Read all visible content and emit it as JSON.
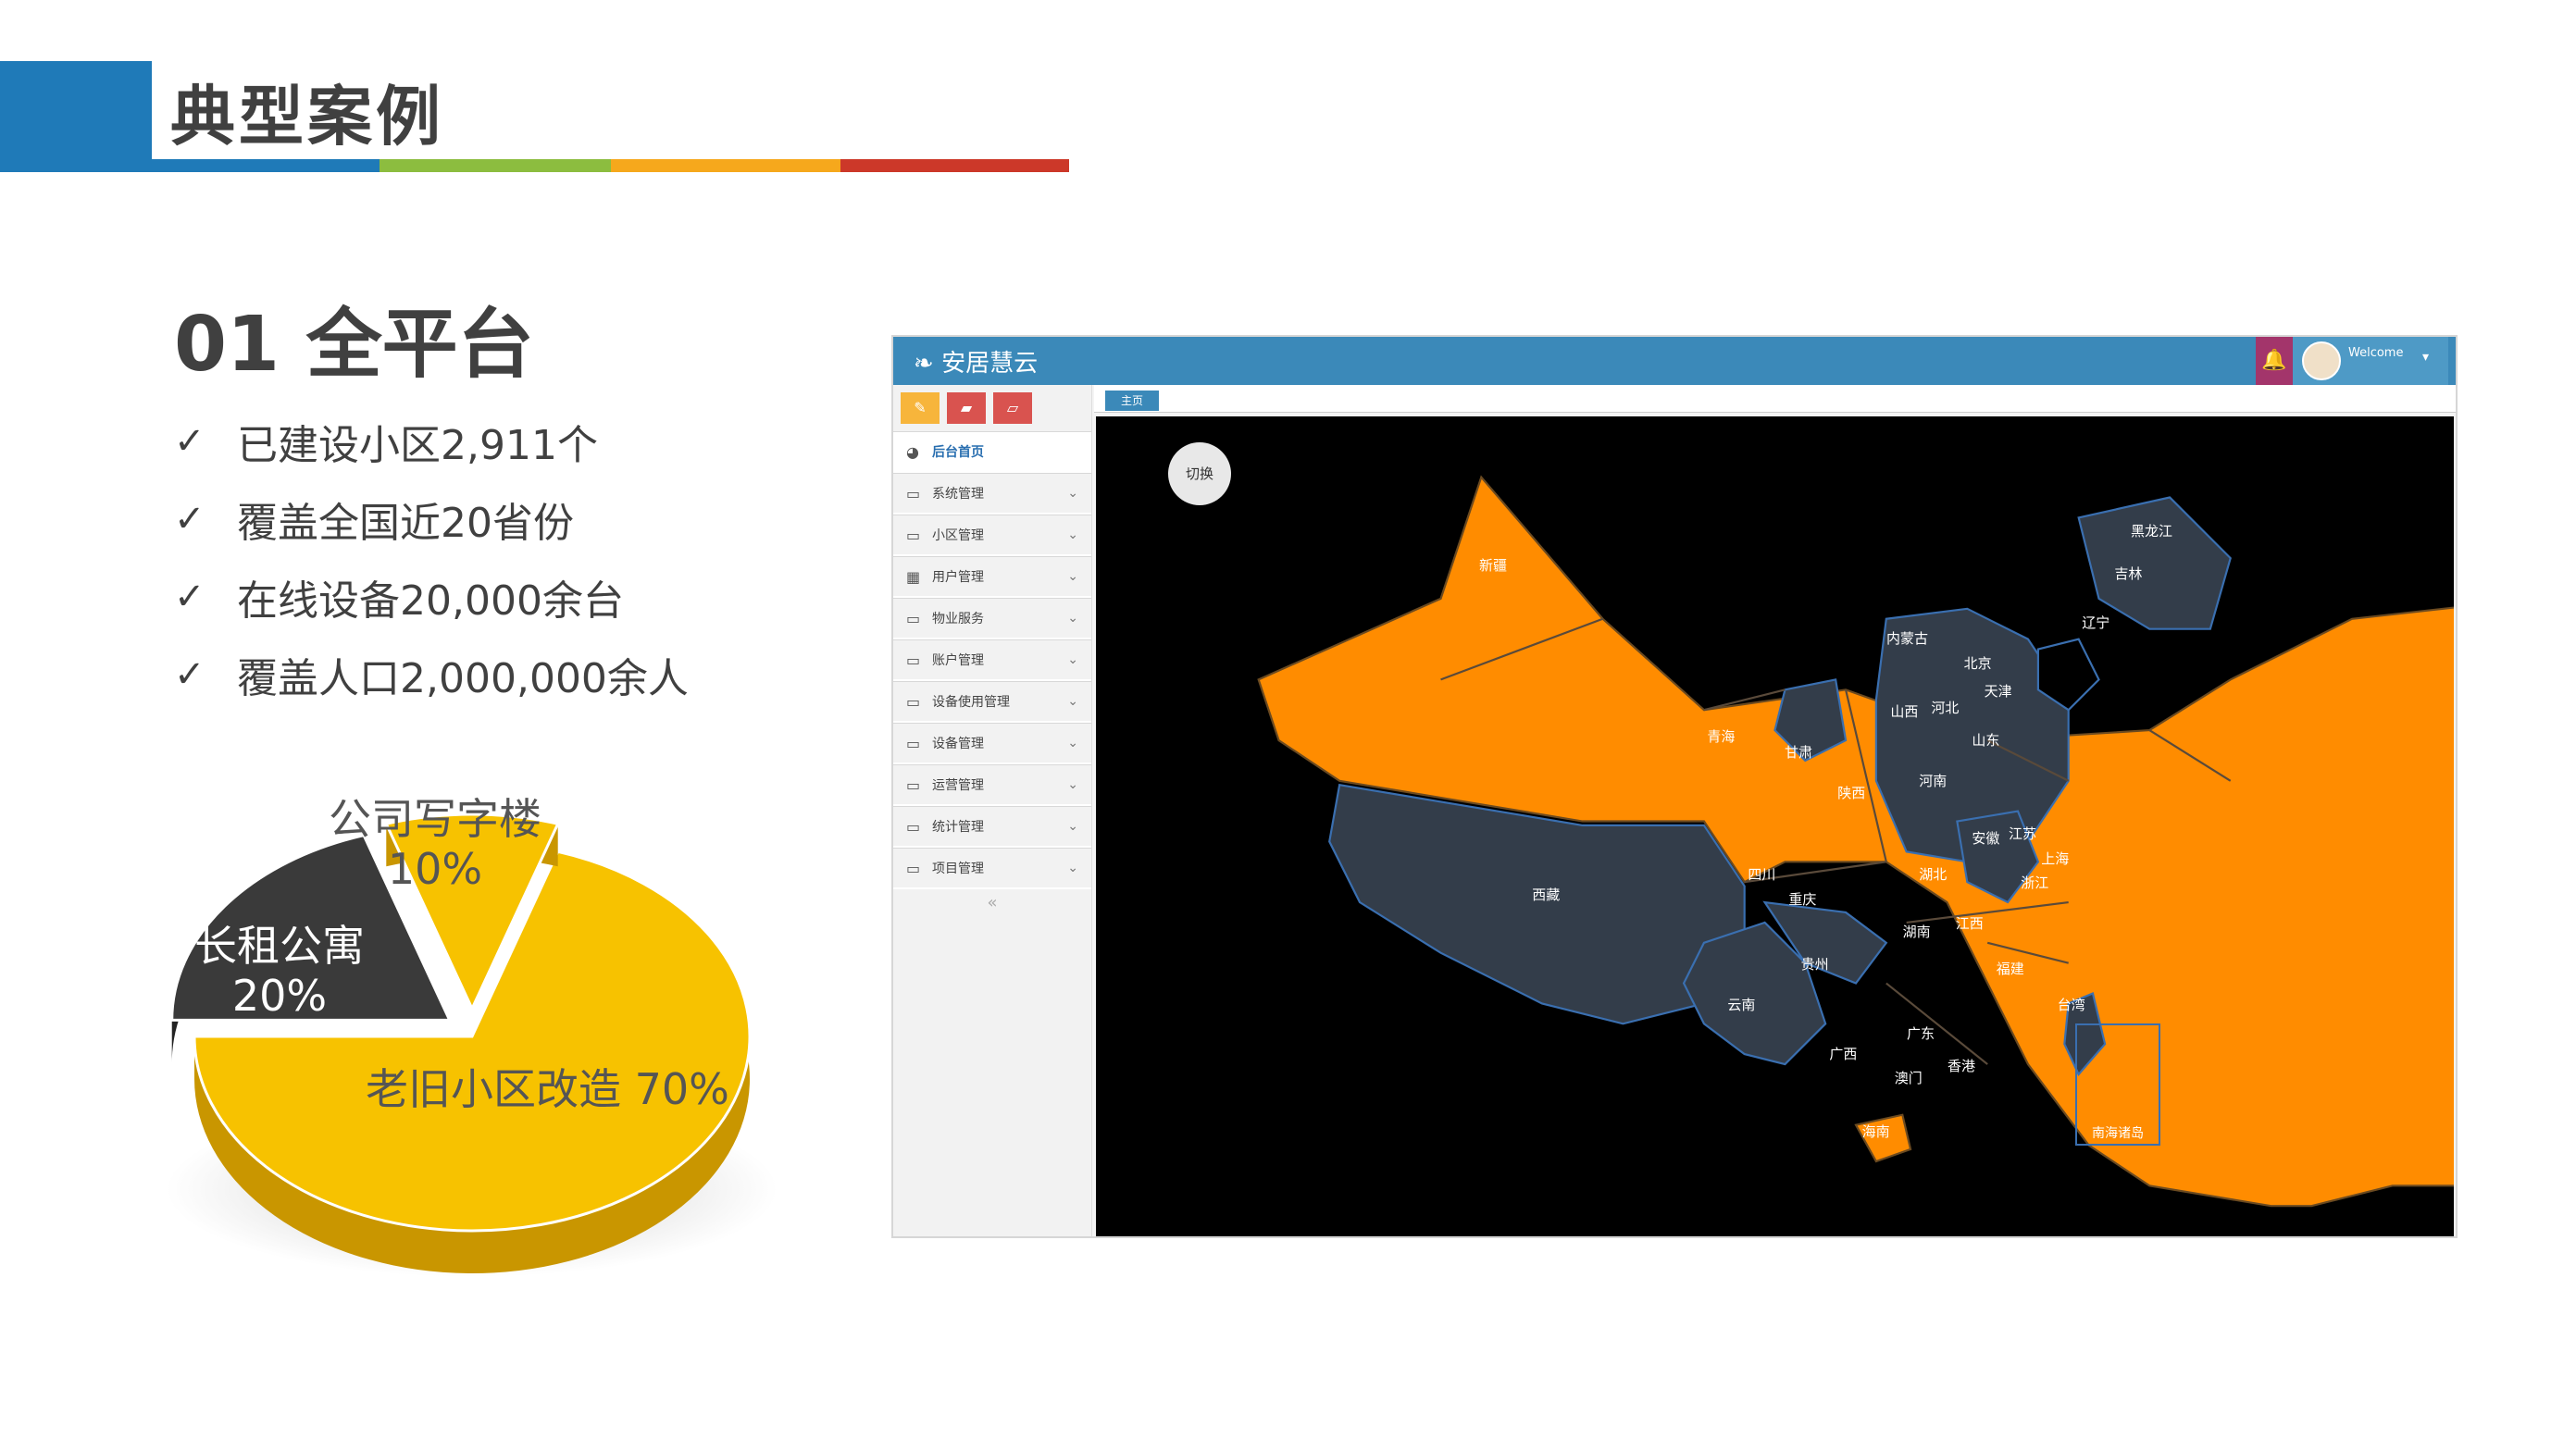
{
  "header": {
    "title": "典型案例"
  },
  "section": {
    "title": "01 全平台",
    "bullets": [
      "已建设小区2,911个",
      "覆盖全国近20省份",
      "在线设备20,000余台",
      "覆盖人口2,000,000余人"
    ]
  },
  "chart_data": {
    "type": "pie",
    "slices": [
      {
        "label": "老旧小区改造",
        "value": 70,
        "color": "#f7c200",
        "text": "老旧小区改造 70%"
      },
      {
        "label": "长租公寓",
        "value": 20,
        "color": "#3a3a3a",
        "text_line1": "长租公寓",
        "text_line2": "20%"
      },
      {
        "label": "公司写字楼",
        "value": 10,
        "color": "#f7c200",
        "text_line1": "公司写字楼",
        "text_line2": "10%"
      }
    ]
  },
  "app": {
    "logo_text": "安居慧云",
    "welcome": "Welcome",
    "tab_label": "主页",
    "switch_label": "切换",
    "sidebar": [
      {
        "label": "后台首页",
        "icon": "dashboard-icon"
      },
      {
        "label": "系统管理",
        "icon": "monitor-icon"
      },
      {
        "label": "小区管理",
        "icon": "monitor-icon"
      },
      {
        "label": "用户管理",
        "icon": "grid-icon"
      },
      {
        "label": "物业服务",
        "icon": "monitor-icon"
      },
      {
        "label": "账户管理",
        "icon": "monitor-icon"
      },
      {
        "label": "设备使用管理",
        "icon": "monitor-icon"
      },
      {
        "label": "设备管理",
        "icon": "monitor-icon"
      },
      {
        "label": "运营管理",
        "icon": "monitor-icon"
      },
      {
        "label": "统计管理",
        "icon": "monitor-icon"
      },
      {
        "label": "项目管理",
        "icon": "monitor-icon"
      }
    ],
    "colors": {
      "covered": "#ff8c00",
      "uncovered": "#333d4a",
      "header": "#3b89b9"
    },
    "map_labels": {
      "xinjiang": "新疆",
      "xizang": "西藏",
      "qinghai": "青海",
      "gansu": "甘肃",
      "neimenggu": "内蒙古",
      "heilongjiang": "黑龙江",
      "jilin": "吉林",
      "liaoning": "辽宁",
      "beijing": "北京",
      "tianjin": "天津",
      "hebei": "河北",
      "shanxi": "山西",
      "shandong": "山东",
      "henan": "河南",
      "shaanxi": "陕西",
      "jiangsu": "江苏",
      "anhui": "安徽",
      "shanghai": "上海",
      "zhejiang": "浙江",
      "hubei": "湖北",
      "sichuan": "四川",
      "chongqing": "重庆",
      "hunan": "湖南",
      "jiangxi": "江西",
      "guizhou": "贵州",
      "yunnan": "云南",
      "guangxi": "广西",
      "guangdong": "广东",
      "fujian": "福建",
      "taiwan": "台湾",
      "hainan": "海南",
      "hongkong": "香港",
      "macau": "澳门",
      "nanhai": "南海诸岛"
    }
  }
}
